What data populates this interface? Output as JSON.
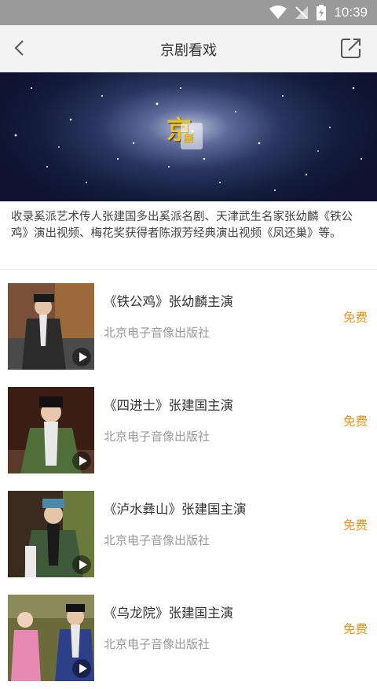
{
  "status_bar": {
    "time": "10:39",
    "icons": [
      "wifi-icon",
      "signal-icon",
      "battery-icon"
    ]
  },
  "nav": {
    "title": "京剧看戏",
    "back_icon": "chevron-left-icon",
    "share_icon": "share-external-icon"
  },
  "banner": {
    "logo_char_1": "京",
    "logo_char_2": "剧"
  },
  "description": "收录奚派艺术传人张建国多出奚派名剧、天津武生名家张幼麟《铁公鸡》演出视频、梅花奖获得者陈淑芳经典演出视频《凤还巢》等。",
  "items": [
    {
      "title": "《铁公鸡》张幼麟主演",
      "publisher": "北京电子音像出版社",
      "price": "免费"
    },
    {
      "title": "《四进士》张建国主演",
      "publisher": "北京电子音像出版社",
      "price": "免费"
    },
    {
      "title": "《泸水彝山》张建国主演",
      "publisher": "北京电子音像出版社",
      "price": "免费"
    },
    {
      "title": "《乌龙院》张建国主演",
      "publisher": "北京电子音像出版社",
      "price": "免费"
    }
  ],
  "colors": {
    "price": "#f39018",
    "status_bar": "#9a9a9a",
    "nav_bar": "#f3f3f3"
  }
}
